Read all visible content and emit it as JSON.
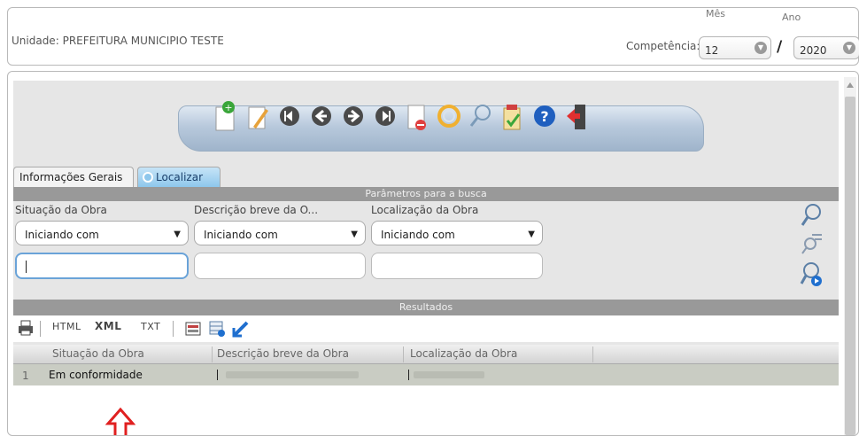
{
  "header": {
    "unit_label": "Unidade:",
    "unit_value": "PREFEITURA MUNICIPIO TESTE",
    "competencia_label": "Competência:",
    "mes_label": "Mês",
    "mes_value": "12",
    "ano_label": "Ano",
    "ano_value": "2020",
    "separator": "/"
  },
  "toolbar": {
    "icons": [
      "new-document-icon",
      "edit-icon",
      "first-record-icon",
      "previous-record-icon",
      "next-record-icon",
      "last-record-icon",
      "delete-document-icon",
      "refresh-icon",
      "search-icon",
      "checklist-icon",
      "help-icon",
      "exit-icon"
    ]
  },
  "tabs": [
    {
      "label": "Informações Gerais",
      "active": false
    },
    {
      "label": "Localizar",
      "active": true
    }
  ],
  "search": {
    "section_title": "Parâmetros para a busca",
    "columns": [
      {
        "label": "Situação da Obra",
        "operator": "Iniciando com",
        "value": ""
      },
      {
        "label": "Descrição breve da O...",
        "operator": "Iniciando com",
        "value": ""
      },
      {
        "label": "Localização da Obra",
        "operator": "Iniciando com",
        "value": ""
      }
    ]
  },
  "results": {
    "section_title": "Resultados",
    "export": {
      "html": "HTML",
      "xml": "XML",
      "txt": "TXT"
    },
    "headers": [
      "Situação da Obra",
      "Descrição breve da Obra",
      "Localização da Obra"
    ],
    "rows": [
      {
        "num": "1",
        "situacao": "Em conformidade"
      }
    ]
  },
  "colors": {
    "accent_tab": "#8ec7ec",
    "section_bar": "#999999",
    "selected_row": "#c9ccc3",
    "annotation_arrow": "#e02020"
  }
}
